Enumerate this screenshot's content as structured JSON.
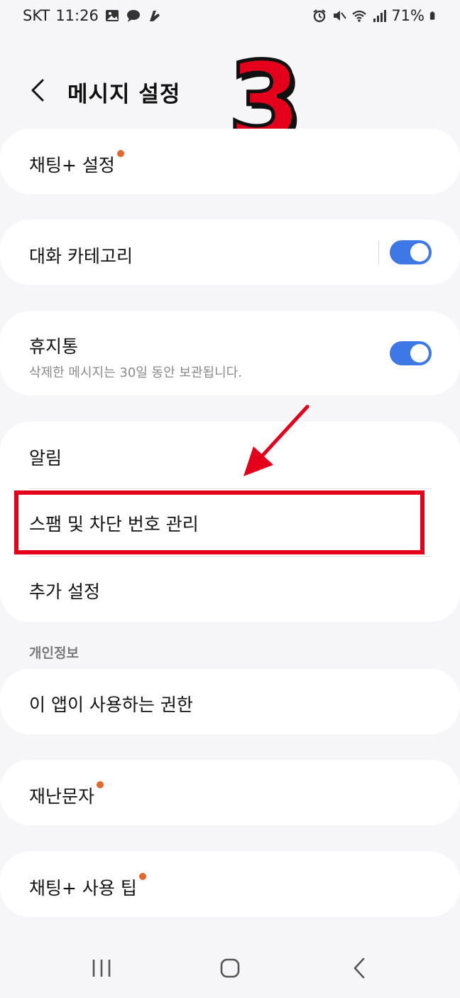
{
  "status_bar": {
    "carrier": "SKT",
    "time": "11:26",
    "battery": "71%"
  },
  "header": {
    "title": "메시지 설정"
  },
  "settings": {
    "chat_plus_settings": "채팅+ 설정",
    "conversation_categories": "대화 카테고리",
    "trash": "휴지통",
    "trash_description": "삭제한 메시지는 30일 동안 보관됩니다.",
    "notifications": "알림",
    "spam_block": "스팸 및 차단 번호 관리",
    "more_settings": "추가 설정",
    "privacy_section": "개인정보",
    "app_permissions": "이 앱이 사용하는 권한",
    "emergency_alerts": "재난문자",
    "chat_plus_tips": "채팅+ 사용 팁"
  },
  "toggles": {
    "conversation_categories": true,
    "trash": true
  },
  "annotation": {
    "step_number": "3",
    "highlight_color": "#e4001a"
  },
  "colors": {
    "accent": "#3e78e6",
    "badge": "#e6672c"
  }
}
